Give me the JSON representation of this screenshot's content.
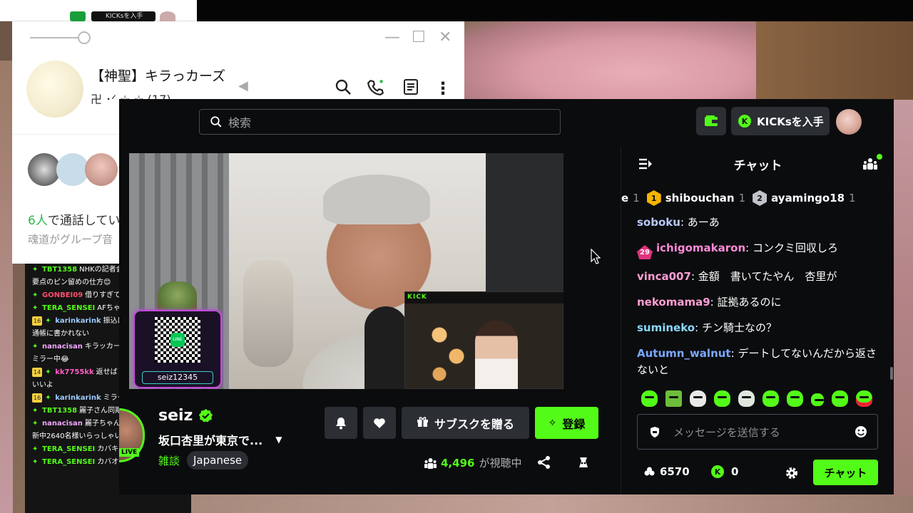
{
  "desktop": {
    "mini_window": {
      "kicks_label": "KICKsを入手"
    }
  },
  "line_window": {
    "group_title": "【神聖】キラっカーズ",
    "group_subtitle": "卍 ･ᐟ ☆ ☆ (17)",
    "call_count": "6人",
    "call_status": "で通話してい",
    "call_note": "魂道がグループ音"
  },
  "side_comments": [
    {
      "user": "TBT1358",
      "text": "NHKの記者会",
      "color": "#53fc18"
    },
    {
      "user": "",
      "text": "要点のピン留めの仕方😊",
      "color": "#ffffff"
    },
    {
      "user": "GONBEI09",
      "text": "借りすぎて",
      "color": "#ff4d6d"
    },
    {
      "user": "TERA_SENSEI",
      "text": "AFちゃ",
      "color": "#53fc18"
    },
    {
      "user": "karinkarink",
      "text": "振込は金銭",
      "color": "#9ecbff",
      "badge": "16"
    },
    {
      "user": "",
      "text": "通帳に書かれない",
      "color": "#ffffff"
    },
    {
      "user": "nanacisan",
      "text": "キラッカー",
      "color": "#f1a7ff"
    },
    {
      "user": "",
      "text": "ミラー中😂",
      "color": "#ffffff"
    },
    {
      "user": "kk7755kk",
      "text": "返せば",
      "color": "#ff5ec4",
      "badge": "14"
    },
    {
      "user": "",
      "text": "いいよ",
      "color": "#ffffff"
    },
    {
      "user": "karinkarink",
      "text": "ミラー星人",
      "color": "#9ecbff",
      "badge": "16"
    },
    {
      "user": "TBT1358",
      "text": "麗子さん同期",
      "color": "#53fc18"
    },
    {
      "user": "nanacisan",
      "text": "麗子ちゃん",
      "color": "#f1a7ff"
    },
    {
      "user": "",
      "text": "新中2640名様いらっしゃい",
      "color": "#ffffff"
    },
    {
      "user": "TERA_SENSEI",
      "text": "カバキ",
      "color": "#53fc18"
    },
    {
      "user": "TERA_SENSEI",
      "text": "カバオの画力よ😊",
      "color": "#53fc18"
    }
  ],
  "kick": {
    "search_placeholder": "検索",
    "kicks_button": "KICKsを入手",
    "overlay": {
      "pip_brand": "KICK",
      "qr_handle": "seiz12345",
      "line_label": "LINE"
    },
    "channel": {
      "name": "seiz",
      "live_label": "LIVE",
      "title": "坂口杏里が東京で...",
      "category": "雑談",
      "language": "Japanese"
    },
    "actions": {
      "gift_label": "サブスクを贈る",
      "follow_label": "登録"
    },
    "viewers": {
      "count": "4,496",
      "suffix": "が視聴中"
    },
    "chat": {
      "title": "チャット",
      "leaderboard": [
        {
          "rank": "",
          "name": "e",
          "count": "1",
          "color": "#f4b400"
        },
        {
          "rank": "1",
          "name": "shibouchan",
          "count": "1",
          "color": "#f4b400"
        },
        {
          "rank": "2",
          "name": "ayamingo18",
          "count": "1",
          "color": "#c0c4c9"
        }
      ],
      "messages": [
        {
          "user": "soboku",
          "text": "あーあ",
          "color": "#b9c8ff"
        },
        {
          "user": "ichigomakaron",
          "text": "コンクミ回収しろ",
          "color": "#ff8ad8",
          "sub": "29"
        },
        {
          "user": "vinca007",
          "text": "金額　書いてたやん　杏里が",
          "color": "#ff9ed4"
        },
        {
          "user": "nekomama9",
          "text": "証拠あるのに",
          "color": "#ff9ed4"
        },
        {
          "user": "sumineko",
          "text": "チン騎士なの？",
          "color": "#8ad8ff"
        },
        {
          "user": "Autumn_walnut",
          "text": "デートしてないんだから返さないと",
          "color": "#7aa8ff"
        }
      ],
      "input_placeholder": "メッセージを送信する",
      "points": "6570",
      "kicks": "0",
      "send_label": "チャット"
    }
  }
}
